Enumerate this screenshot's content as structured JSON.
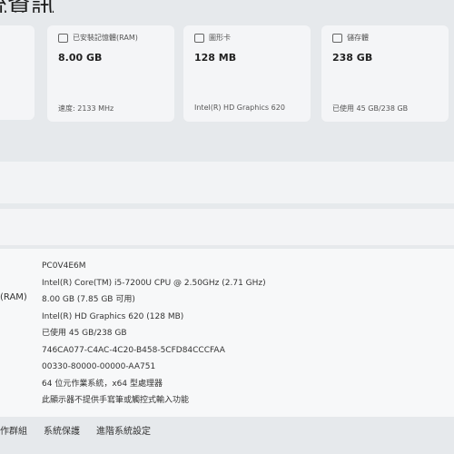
{
  "page": {
    "title": "統資訊"
  },
  "cards": [
    {
      "label": "已安裝記憶體(RAM)",
      "value": "8.00 GB",
      "sub": "速度: 2133 MHz",
      "icon": "memory-icon"
    },
    {
      "label": "圖形卡",
      "value": "128 MB",
      "sub": "Intel(R) HD Graphics 620",
      "icon": "graphics-card-icon"
    },
    {
      "label": "儲存體",
      "value": "238 GB",
      "sub": "已使用 45 GB/238 GB",
      "icon": "storage-icon"
    }
  ],
  "specs": {
    "ram_label": "(RAM)",
    "values": [
      "PC0V4E6M",
      "Intel(R) Core(TM) i5-7200U CPU @ 2.50GHz   (2.71 GHz)",
      "8.00 GB (7.85 GB 可用)",
      "Intel(R) HD Graphics 620 (128 MB)",
      "已使用 45 GB/238 GB",
      "746CA077-C4AC-4C20-B458-5CFD84CCCFAA",
      "00330-80000-00000-AA751",
      "64 位元作業系統，x64 型處理器",
      "此顯示器不提供手寫筆或觸控式輸入功能"
    ]
  },
  "links": [
    "工作群組",
    "系統保護",
    "進階系統設定"
  ]
}
